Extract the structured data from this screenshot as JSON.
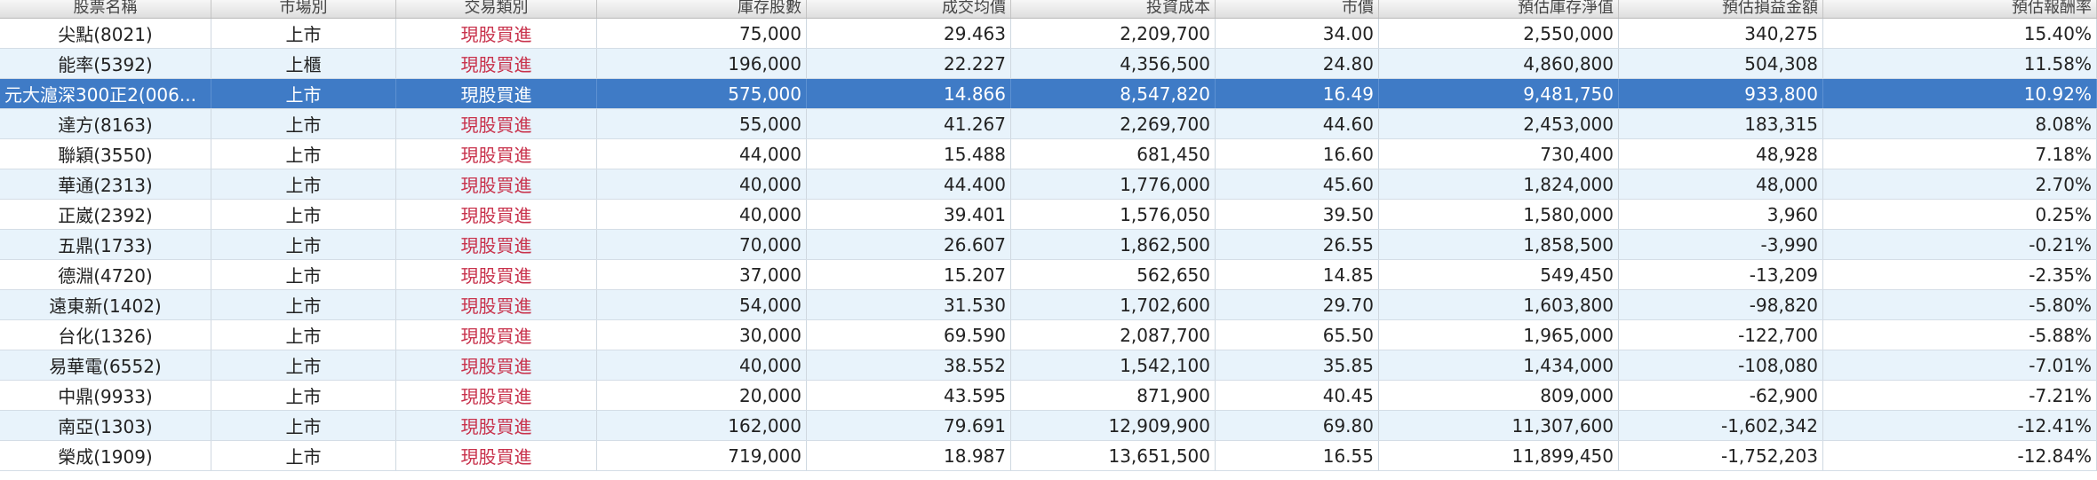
{
  "columns": [
    "股票名稱",
    "市場別",
    "交易類別",
    "庫存股數",
    "成交均價",
    "投資成本",
    "市價",
    "預估庫存淨值",
    "預估損益金額",
    "預估報酬率"
  ],
  "rows": [
    [
      "尖點(8021)",
      "上市",
      "現股買進",
      "75,000",
      "29.463",
      "2,209,700",
      "34.00",
      "2,550,000",
      "340,275",
      "15.40%"
    ],
    [
      "能率(5392)",
      "上櫃",
      "現股買進",
      "196,000",
      "22.227",
      "4,356,500",
      "24.80",
      "4,860,800",
      "504,308",
      "11.58%"
    ],
    [
      "元大滬深300正2(006...",
      "上市",
      "現股買進",
      "575,000",
      "14.866",
      "8,547,820",
      "16.49",
      "9,481,750",
      "933,800",
      "10.92%"
    ],
    [
      "達方(8163)",
      "上市",
      "現股買進",
      "55,000",
      "41.267",
      "2,269,700",
      "44.60",
      "2,453,000",
      "183,315",
      "8.08%"
    ],
    [
      "聯穎(3550)",
      "上市",
      "現股買進",
      "44,000",
      "15.488",
      "681,450",
      "16.60",
      "730,400",
      "48,928",
      "7.18%"
    ],
    [
      "華通(2313)",
      "上市",
      "現股買進",
      "40,000",
      "44.400",
      "1,776,000",
      "45.60",
      "1,824,000",
      "48,000",
      "2.70%"
    ],
    [
      "正崴(2392)",
      "上市",
      "現股買進",
      "40,000",
      "39.401",
      "1,576,050",
      "39.50",
      "1,580,000",
      "3,960",
      "0.25%"
    ],
    [
      "五鼎(1733)",
      "上市",
      "現股買進",
      "70,000",
      "26.607",
      "1,862,500",
      "26.55",
      "1,858,500",
      "-3,990",
      "-0.21%"
    ],
    [
      "德淵(4720)",
      "上市",
      "現股買進",
      "37,000",
      "15.207",
      "562,650",
      "14.85",
      "549,450",
      "-13,209",
      "-2.35%"
    ],
    [
      "遠東新(1402)",
      "上市",
      "現股買進",
      "54,000",
      "31.530",
      "1,702,600",
      "29.70",
      "1,603,800",
      "-98,820",
      "-5.80%"
    ],
    [
      "台化(1326)",
      "上市",
      "現股買進",
      "30,000",
      "69.590",
      "2,087,700",
      "65.50",
      "1,965,000",
      "-122,700",
      "-5.88%"
    ],
    [
      "易華電(6552)",
      "上市",
      "現股買進",
      "40,000",
      "38.552",
      "1,542,100",
      "35.85",
      "1,434,000",
      "-108,080",
      "-7.01%"
    ],
    [
      "中鼎(9933)",
      "上市",
      "現股買進",
      "20,000",
      "43.595",
      "871,900",
      "40.45",
      "809,000",
      "-62,900",
      "-7.21%"
    ],
    [
      "南亞(1303)",
      "上市",
      "現股買進",
      "162,000",
      "79.691",
      "12,909,900",
      "69.80",
      "11,307,600",
      "-1,602,342",
      "-12.41%"
    ],
    [
      "榮成(1909)",
      "上市",
      "現股買進",
      "719,000",
      "18.987",
      "13,651,500",
      "16.55",
      "11,899,450",
      "-1,752,203",
      "-12.84%"
    ]
  ],
  "selected_row": 2
}
